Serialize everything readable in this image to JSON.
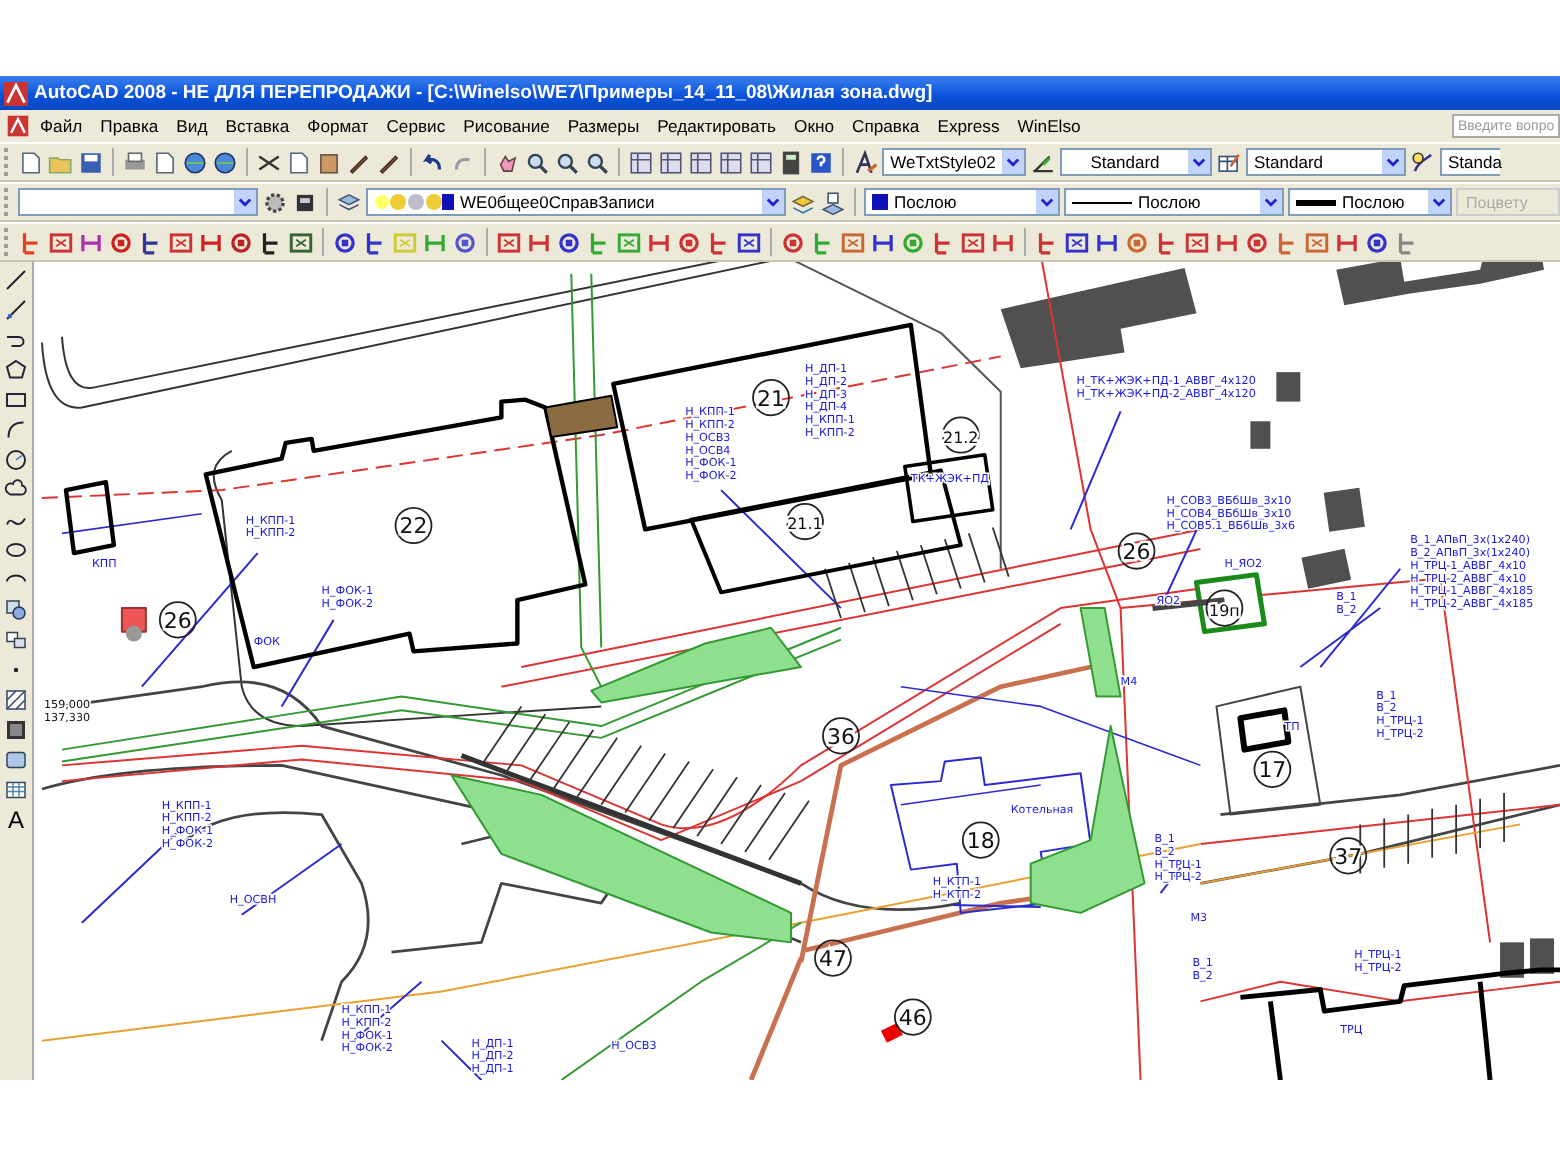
{
  "window": {
    "title": "AutoCAD 2008 - НЕ ДЛЯ ПЕРЕПРОДАЖИ - [C:\\Winelso\\WE7\\Примеры_14_11_08\\Жилая зона.dwg]"
  },
  "menu": [
    "Файл",
    "Правка",
    "Вид",
    "Вставка",
    "Формат",
    "Сервис",
    "Рисование",
    "Размеры",
    "Редактировать",
    "Окно",
    "Справка",
    "Express",
    "WinElso"
  ],
  "help_search": {
    "placeholder": "Введите вопро"
  },
  "styles_toolbar": {
    "text_style": "WeTxtStyle02",
    "dim_style": "Standard",
    "table_style": "Standard",
    "multileader_style": "Standa"
  },
  "properties_toolbar": {
    "layer": "WE0бщее0СправЗаписи",
    "color_setting": "Послою",
    "linetype": "Послою",
    "lineweight": "Послою",
    "plot_style": {
      "value": "Поцвету",
      "disabled": true
    }
  },
  "draw_toolbar": {
    "text_tool": "A"
  },
  "drawing": {
    "building_numbers": [
      "22",
      "21",
      "21.2",
      "21.1",
      "26",
      "26",
      "36",
      "18",
      "17",
      "37",
      "47",
      "46",
      "19п"
    ],
    "labels": [
      {
        "kind": "cable",
        "lines": [
          "Н_КПП-1",
          "Н_КПП-2"
        ]
      },
      {
        "kind": "cable",
        "lines": [
          "Н_ФОК-1",
          "Н_ФОК-2"
        ]
      },
      {
        "kind": "name",
        "lines": [
          "ФОК"
        ]
      },
      {
        "kind": "name",
        "lines": [
          "КПП"
        ]
      },
      {
        "kind": "cable",
        "lines": [
          "Н_КПП-1",
          "Н_КПП-2",
          "Н_ОСВ3",
          "Н_ОСВ4",
          "Н_ФОК-1",
          "Н_ФОК-2"
        ]
      },
      {
        "kind": "cable",
        "lines": [
          "Н_ДП-1",
          "Н_ДП-2",
          "Н_ДП-3",
          "Н_ДП-4",
          "Н_КПП-1",
          "Н_КПП-2"
        ]
      },
      {
        "kind": "cable",
        "lines": [
          "Н_ТК+ЖЭК+ПД-1_АВВГ_4х120",
          "Н_ТК+ЖЭК+ПД-2_АВВГ_4х120"
        ]
      },
      {
        "kind": "name",
        "lines": [
          "ТК+ЖЭК+ПД"
        ]
      },
      {
        "kind": "cable",
        "lines": [
          "Н_СОВ3_ВБбШв_3х10",
          "Н_СОВ4_ВБбШв_3х10",
          "Н_СОВ5.1_ВБбШв_3х6"
        ]
      },
      {
        "kind": "name",
        "lines": [
          "Н_ЯО2"
        ]
      },
      {
        "kind": "name",
        "lines": [
          "ЯО2"
        ]
      },
      {
        "kind": "cable",
        "lines": [
          "В_1_АПвП_3х(1х240)",
          "В_2_АПвП_3х(1х240)",
          "Н_ТРЦ-1_АВВГ_4х10",
          "Н_ТРЦ-2_АВВГ_4х10",
          "Н_ТРЦ-1_АВВГ_4х185",
          "Н_ТРЦ-2_АВВГ_4х185"
        ]
      },
      {
        "kind": "cable",
        "lines": [
          "В_1",
          "В_2"
        ]
      },
      {
        "kind": "cable",
        "lines": [
          "В_1",
          "В_2",
          "Н_ТРЦ-1",
          "Н_ТРЦ-2"
        ]
      },
      {
        "kind": "name",
        "lines": [
          "ТП"
        ]
      },
      {
        "kind": "name",
        "lines": [
          "Котельная"
        ]
      },
      {
        "kind": "cable",
        "lines": [
          "В_1",
          "В_2",
          "Н_ТРЦ-1",
          "Н_ТРЦ-2"
        ]
      },
      {
        "kind": "cable",
        "lines": [
          "Н_КТП-1",
          "Н_КТП-2"
        ]
      },
      {
        "kind": "cable",
        "lines": [
          "Н_КПП-1",
          "Н_КПП-2",
          "Н_ФОК-1",
          "Н_ФОК-2"
        ]
      },
      {
        "kind": "cable",
        "lines": [
          "Н_ОСВН"
        ]
      },
      {
        "kind": "cable",
        "lines": [
          "Н_КПП-1",
          "Н_КПП-2",
          "Н_ФОК-1",
          "Н_ФОК-2"
        ]
      },
      {
        "kind": "cable",
        "lines": [
          "Н_ДП-1",
          "Н_ДП-2",
          "Н_ДП-1"
        ]
      },
      {
        "kind": "cable",
        "lines": [
          "Н_ОСВ3"
        ]
      },
      {
        "kind": "cable",
        "lines": [
          "Н_ТРЦ-1",
          "Н_ТРЦ-2"
        ]
      },
      {
        "kind": "cable",
        "lines": [
          "В_1",
          "В_2"
        ]
      },
      {
        "kind": "name",
        "lines": [
          "ТРЦ"
        ]
      },
      {
        "kind": "coordinate",
        "lines": [
          "159,000",
          "137,330"
        ]
      },
      {
        "kind": "name",
        "lines": [
          "М4"
        ]
      },
      {
        "kind": "name",
        "lines": [
          "М3"
        ]
      }
    ]
  }
}
